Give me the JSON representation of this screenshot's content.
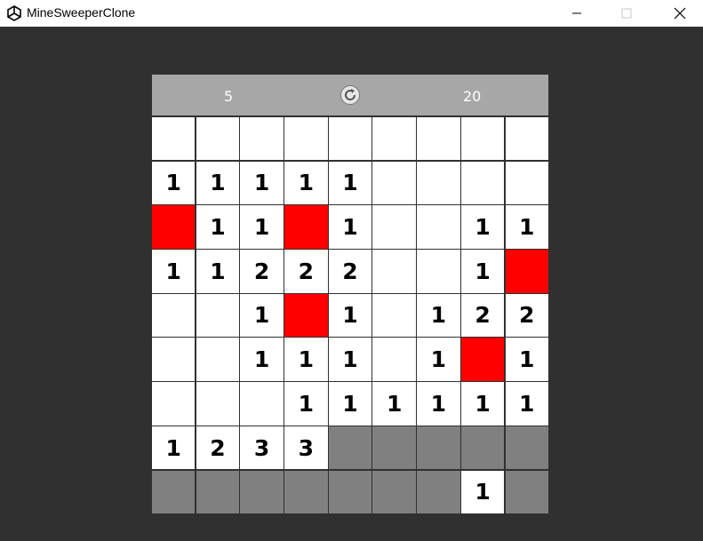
{
  "window": {
    "title": "MineSweeperClone"
  },
  "hud": {
    "mines_left": "5",
    "timer": "20"
  },
  "colors": {
    "revealed": "#ffffff",
    "hidden": "#808080",
    "mine": "#ff0000",
    "hud": "#a7a7a7",
    "background": "#303030"
  },
  "icons": {
    "app": "unity-logo-icon",
    "reset": "refresh-icon",
    "minimize": "minimize-icon",
    "maximize": "maximize-icon",
    "close": "close-icon"
  },
  "board": {
    "rows": [
      [
        "",
        "",
        "",
        "",
        "",
        "",
        "",
        "",
        ""
      ],
      [
        "1",
        "1",
        "1",
        "1",
        "1",
        "",
        "",
        "",
        ""
      ],
      [
        "M",
        "1",
        "1",
        "M",
        "1",
        "",
        "",
        "1",
        "1"
      ],
      [
        "1",
        "1",
        "2",
        "2",
        "2",
        "",
        "",
        "1",
        "M"
      ],
      [
        "",
        "",
        "1",
        "M",
        "1",
        "",
        "1",
        "2",
        "2"
      ],
      [
        "",
        "",
        "1",
        "1",
        "1",
        "",
        "1",
        "M",
        "1"
      ],
      [
        "",
        "",
        "",
        "1",
        "1",
        "1",
        "1",
        "1",
        "1"
      ],
      [
        "1",
        "2",
        "3",
        "3",
        "H",
        "H",
        "H",
        "H",
        "H"
      ],
      [
        "H",
        "H",
        "H",
        "H",
        "H",
        "H",
        "H",
        "1",
        "H"
      ]
    ]
  }
}
